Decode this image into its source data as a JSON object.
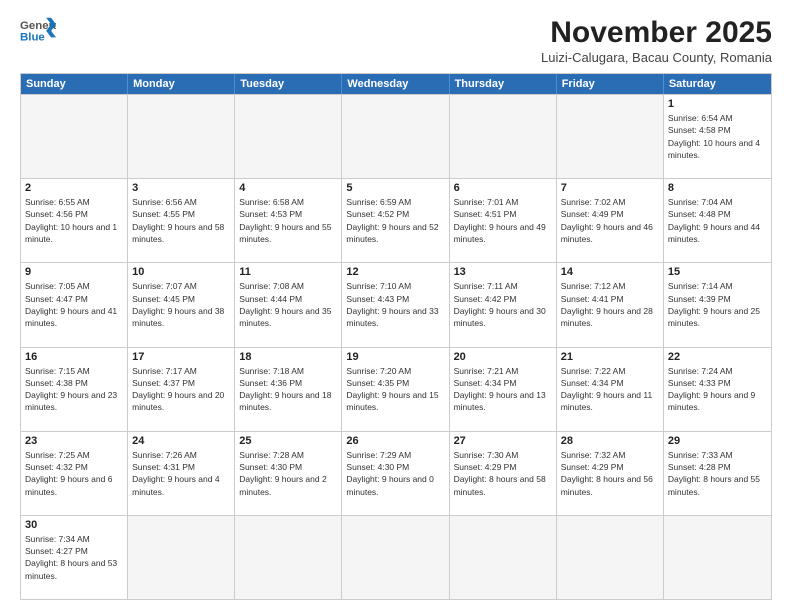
{
  "header": {
    "logo_general": "General",
    "logo_blue": "Blue",
    "month_title": "November 2025",
    "subtitle": "Luizi-Calugara, Bacau County, Romania"
  },
  "weekdays": [
    "Sunday",
    "Monday",
    "Tuesday",
    "Wednesday",
    "Thursday",
    "Friday",
    "Saturday"
  ],
  "rows": [
    [
      {
        "day": "",
        "empty": true
      },
      {
        "day": "",
        "empty": true
      },
      {
        "day": "",
        "empty": true
      },
      {
        "day": "",
        "empty": true
      },
      {
        "day": "",
        "empty": true
      },
      {
        "day": "",
        "empty": true
      },
      {
        "day": "1",
        "sunrise": "Sunrise: 6:54 AM",
        "sunset": "Sunset: 4:58 PM",
        "daylight": "Daylight: 10 hours and 4 minutes."
      }
    ],
    [
      {
        "day": "2",
        "sunrise": "Sunrise: 6:55 AM",
        "sunset": "Sunset: 4:56 PM",
        "daylight": "Daylight: 10 hours and 1 minute."
      },
      {
        "day": "3",
        "sunrise": "Sunrise: 6:56 AM",
        "sunset": "Sunset: 4:55 PM",
        "daylight": "Daylight: 9 hours and 58 minutes."
      },
      {
        "day": "4",
        "sunrise": "Sunrise: 6:58 AM",
        "sunset": "Sunset: 4:53 PM",
        "daylight": "Daylight: 9 hours and 55 minutes."
      },
      {
        "day": "5",
        "sunrise": "Sunrise: 6:59 AM",
        "sunset": "Sunset: 4:52 PM",
        "daylight": "Daylight: 9 hours and 52 minutes."
      },
      {
        "day": "6",
        "sunrise": "Sunrise: 7:01 AM",
        "sunset": "Sunset: 4:51 PM",
        "daylight": "Daylight: 9 hours and 49 minutes."
      },
      {
        "day": "7",
        "sunrise": "Sunrise: 7:02 AM",
        "sunset": "Sunset: 4:49 PM",
        "daylight": "Daylight: 9 hours and 46 minutes."
      },
      {
        "day": "8",
        "sunrise": "Sunrise: 7:04 AM",
        "sunset": "Sunset: 4:48 PM",
        "daylight": "Daylight: 9 hours and 44 minutes."
      }
    ],
    [
      {
        "day": "9",
        "sunrise": "Sunrise: 7:05 AM",
        "sunset": "Sunset: 4:47 PM",
        "daylight": "Daylight: 9 hours and 41 minutes."
      },
      {
        "day": "10",
        "sunrise": "Sunrise: 7:07 AM",
        "sunset": "Sunset: 4:45 PM",
        "daylight": "Daylight: 9 hours and 38 minutes."
      },
      {
        "day": "11",
        "sunrise": "Sunrise: 7:08 AM",
        "sunset": "Sunset: 4:44 PM",
        "daylight": "Daylight: 9 hours and 35 minutes."
      },
      {
        "day": "12",
        "sunrise": "Sunrise: 7:10 AM",
        "sunset": "Sunset: 4:43 PM",
        "daylight": "Daylight: 9 hours and 33 minutes."
      },
      {
        "day": "13",
        "sunrise": "Sunrise: 7:11 AM",
        "sunset": "Sunset: 4:42 PM",
        "daylight": "Daylight: 9 hours and 30 minutes."
      },
      {
        "day": "14",
        "sunrise": "Sunrise: 7:12 AM",
        "sunset": "Sunset: 4:41 PM",
        "daylight": "Daylight: 9 hours and 28 minutes."
      },
      {
        "day": "15",
        "sunrise": "Sunrise: 7:14 AM",
        "sunset": "Sunset: 4:39 PM",
        "daylight": "Daylight: 9 hours and 25 minutes."
      }
    ],
    [
      {
        "day": "16",
        "sunrise": "Sunrise: 7:15 AM",
        "sunset": "Sunset: 4:38 PM",
        "daylight": "Daylight: 9 hours and 23 minutes."
      },
      {
        "day": "17",
        "sunrise": "Sunrise: 7:17 AM",
        "sunset": "Sunset: 4:37 PM",
        "daylight": "Daylight: 9 hours and 20 minutes."
      },
      {
        "day": "18",
        "sunrise": "Sunrise: 7:18 AM",
        "sunset": "Sunset: 4:36 PM",
        "daylight": "Daylight: 9 hours and 18 minutes."
      },
      {
        "day": "19",
        "sunrise": "Sunrise: 7:20 AM",
        "sunset": "Sunset: 4:35 PM",
        "daylight": "Daylight: 9 hours and 15 minutes."
      },
      {
        "day": "20",
        "sunrise": "Sunrise: 7:21 AM",
        "sunset": "Sunset: 4:34 PM",
        "daylight": "Daylight: 9 hours and 13 minutes."
      },
      {
        "day": "21",
        "sunrise": "Sunrise: 7:22 AM",
        "sunset": "Sunset: 4:34 PM",
        "daylight": "Daylight: 9 hours and 11 minutes."
      },
      {
        "day": "22",
        "sunrise": "Sunrise: 7:24 AM",
        "sunset": "Sunset: 4:33 PM",
        "daylight": "Daylight: 9 hours and 9 minutes."
      }
    ],
    [
      {
        "day": "23",
        "sunrise": "Sunrise: 7:25 AM",
        "sunset": "Sunset: 4:32 PM",
        "daylight": "Daylight: 9 hours and 6 minutes."
      },
      {
        "day": "24",
        "sunrise": "Sunrise: 7:26 AM",
        "sunset": "Sunset: 4:31 PM",
        "daylight": "Daylight: 9 hours and 4 minutes."
      },
      {
        "day": "25",
        "sunrise": "Sunrise: 7:28 AM",
        "sunset": "Sunset: 4:30 PM",
        "daylight": "Daylight: 9 hours and 2 minutes."
      },
      {
        "day": "26",
        "sunrise": "Sunrise: 7:29 AM",
        "sunset": "Sunset: 4:30 PM",
        "daylight": "Daylight: 9 hours and 0 minutes."
      },
      {
        "day": "27",
        "sunrise": "Sunrise: 7:30 AM",
        "sunset": "Sunset: 4:29 PM",
        "daylight": "Daylight: 8 hours and 58 minutes."
      },
      {
        "day": "28",
        "sunrise": "Sunrise: 7:32 AM",
        "sunset": "Sunset: 4:29 PM",
        "daylight": "Daylight: 8 hours and 56 minutes."
      },
      {
        "day": "29",
        "sunrise": "Sunrise: 7:33 AM",
        "sunset": "Sunset: 4:28 PM",
        "daylight": "Daylight: 8 hours and 55 minutes."
      }
    ],
    [
      {
        "day": "30",
        "sunrise": "Sunrise: 7:34 AM",
        "sunset": "Sunset: 4:27 PM",
        "daylight": "Daylight: 8 hours and 53 minutes."
      },
      {
        "day": "",
        "empty": true
      },
      {
        "day": "",
        "empty": true
      },
      {
        "day": "",
        "empty": true
      },
      {
        "day": "",
        "empty": true
      },
      {
        "day": "",
        "empty": true
      },
      {
        "day": "",
        "empty": true
      }
    ]
  ]
}
